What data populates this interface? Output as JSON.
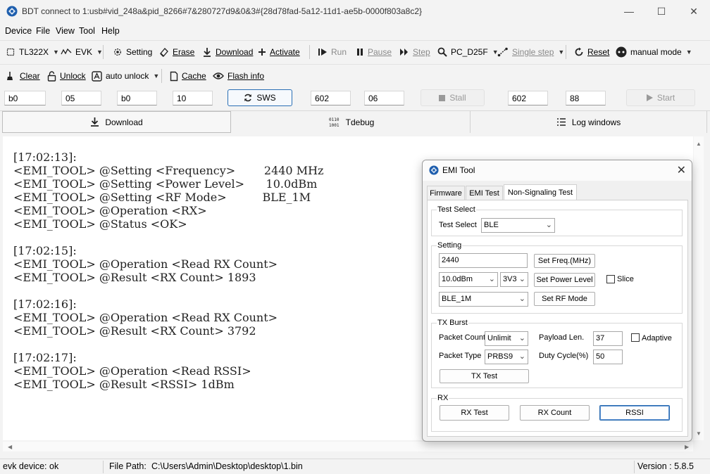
{
  "window": {
    "title": "BDT connect to 1:usb#vid_248a&pid_8266#7&280727d9&0&3#{28d78fad-5a12-11d1-ae5b-0000f803a8c2}",
    "controls": {
      "minimize": "—",
      "maximize": "☐",
      "close": "✕"
    }
  },
  "menu": [
    "Device",
    "File",
    "View",
    "Tool",
    "Help"
  ],
  "toolbar1": {
    "chip": "TL322X",
    "board": "EVK",
    "setting": "Setting",
    "erase": "Erase",
    "download": "Download",
    "activate": "Activate",
    "run": "Run",
    "pause": "Pause",
    "step": "Step",
    "pc": "PC_D25F",
    "single_step": "Single step",
    "reset": "Reset",
    "mode": "manual mode"
  },
  "toolbar2": {
    "clear": "Clear",
    "unlock": "Unlock",
    "auto_unlock": "auto unlock",
    "cache": "Cache",
    "flash_info": "Flash info"
  },
  "inputs": {
    "f1": "b0",
    "f2": "05",
    "f3": "b0",
    "f4": "10",
    "sws": "SWS",
    "f5": "602",
    "f6": "06",
    "stall": "Stall",
    "f7": "602",
    "f8": "88",
    "start": "Start"
  },
  "tabs": {
    "download": "Download",
    "tdebug": "Tdebug",
    "log": "Log windows"
  },
  "log": [
    "[17:02:13]:",
    "<EMI_TOOL> @Setting <Frequency>        2440 MHz",
    "<EMI_TOOL> @Setting <Power Level>      10.0dBm",
    "<EMI_TOOL> @Setting <RF Mode>          BLE_1M",
    "<EMI_TOOL> @Operation <RX>",
    "<EMI_TOOL> @Status <OK>",
    "",
    "[17:02:15]:",
    "<EMI_TOOL> @Operation <Read RX Count>",
    "<EMI_TOOL> @Result <RX Count> 1893",
    "",
    "[17:02:16]:",
    "<EMI_TOOL> @Operation <Read RX Count>",
    "<EMI_TOOL> @Result <RX Count> 3792",
    "",
    "[17:02:17]:",
    "<EMI_TOOL> @Operation <Read RSSI>",
    "<EMI_TOOL> @Result <RSSI> 1dBm"
  ],
  "status": {
    "device": "evk device: ok",
    "file_path_label": "File Path:",
    "file_path": "C:\\Users\\Admin\\Desktop\\desktop\\1.bin",
    "version": "Version : 5.8.5"
  },
  "dialog": {
    "title": "EMI Tool",
    "tabs": [
      "Firmware",
      "EMI Test",
      "Non-Signaling Test"
    ],
    "test_select_group": "Test Select",
    "test_select_label": "Test Select",
    "test_select_value": "BLE",
    "setting_group": "Setting",
    "freq_value": "2440",
    "set_freq": "Set Freq.(MHz)",
    "power_value": "10.0dBm",
    "voltage_value": "3V3",
    "set_power": "Set Power Level",
    "slice": "Slice",
    "rf_mode_value": "BLE_1M",
    "set_rf_mode": "Set RF Mode",
    "tx_group": "TX Burst",
    "packet_count_label": "Packet Count",
    "packet_count_value": "Unlimit",
    "payload_len_label": "Payload Len.",
    "payload_len_value": "37",
    "adaptive": "Adaptive",
    "packet_type_label": "Packet Type",
    "packet_type_value": "PRBS9",
    "duty_cycle_label": "Duty Cycle(%)",
    "duty_cycle_value": "50",
    "tx_test": "TX Test",
    "rx_group": "RX",
    "rx_test": "RX Test",
    "rx_count": "RX Count",
    "rssi": "RSSI"
  }
}
